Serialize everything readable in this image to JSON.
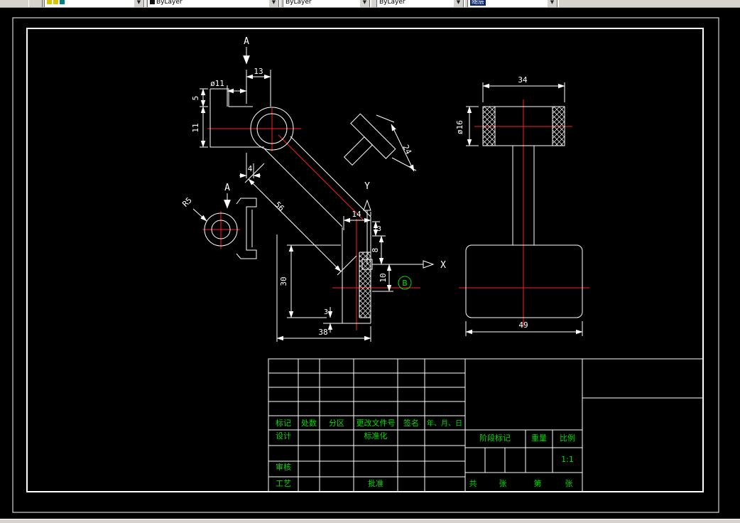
{
  "toolbar": {
    "layer_combo": "",
    "color_combo": "ByLayer",
    "linetype_combo": "ByLayer",
    "lineweight_combo": "ByLayer",
    "plotstyle_combo": "随层"
  },
  "views": {
    "main": {
      "section_a": "A",
      "axis_x": "X",
      "axis_y": "Y",
      "detail_b": "B",
      "dims": {
        "d13": "13",
        "dia11": "ø11",
        "d5": "5",
        "d11": "11",
        "d4": "4",
        "d56": "56",
        "d24": "24",
        "d14": "14",
        "d3_top": "3",
        "d8": "8",
        "d10": "10",
        "d30": "30",
        "d3_bottom": "3",
        "d38": "38"
      }
    },
    "aux": {
      "section_a": "A",
      "radius": "R5"
    },
    "side": {
      "dims": {
        "d34": "34",
        "dia16": "ø16",
        "d49": "49"
      }
    }
  },
  "title_block": {
    "rev_headers": [
      "标记",
      "处数",
      "分区",
      "更改文件号",
      "签名",
      "年、月、日"
    ],
    "design": "设计",
    "standardize": "标准化",
    "check": "审核",
    "process": "工艺",
    "approve": "批准",
    "stage_mark": "阶段标记",
    "weight": "重量",
    "scale_label": "比例",
    "scale_value": "1:1",
    "sheet_total": "共",
    "sheet_total_unit": "张",
    "sheet_no": "第",
    "sheet_no_unit": "张"
  }
}
